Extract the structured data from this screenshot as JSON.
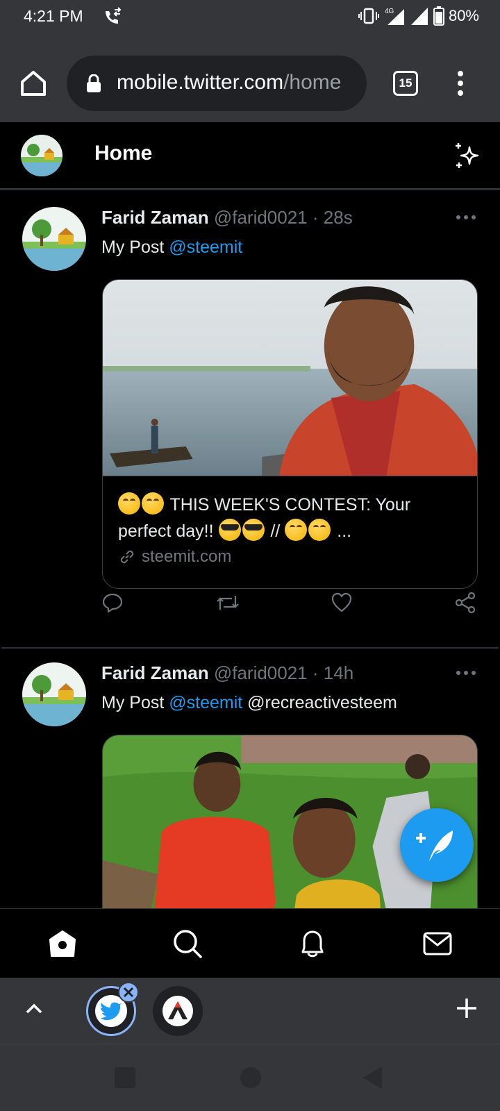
{
  "status_bar": {
    "time": "4:21 PM",
    "network": "4G",
    "battery": "80%"
  },
  "browser": {
    "url_host": "mobile.twitter.com",
    "url_path": "/home",
    "tab_count": "15"
  },
  "header": {
    "title": "Home"
  },
  "tweets": [
    {
      "name": "Farid Zaman",
      "handle": "@farid0021",
      "dot": "·",
      "time": "28s",
      "text_prefix": "My Post ",
      "mention": "@steemit",
      "text_suffix": "",
      "card": {
        "title_part1": " THIS WEEK'S CONTEST: Your perfect day!! ",
        "title_part2": " // ",
        "title_part3": " ...",
        "domain": "steemit.com"
      }
    },
    {
      "name": "Farid Zaman",
      "handle": "@farid0021",
      "dot": "·",
      "time": "14h",
      "text_prefix": "My Post ",
      "mention": "@steemit",
      "text_suffix": " @recreactivesteem"
    }
  ],
  "colors": {
    "accent": "#1d9bf0",
    "background": "#000000",
    "chrome": "#35363a",
    "tab_ring": "#8ab4f8"
  },
  "icons": {
    "fab": "compose-tweet-icon",
    "nav": [
      "home-icon",
      "search-icon",
      "bell-icon",
      "mail-icon"
    ]
  }
}
